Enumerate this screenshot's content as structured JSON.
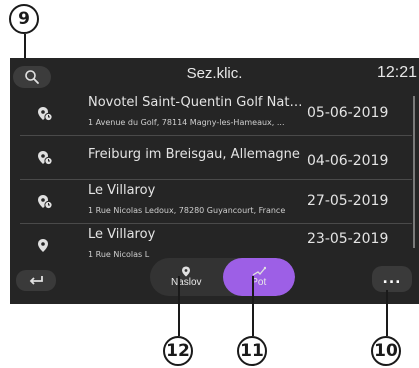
{
  "callouts": {
    "search": "9",
    "address": "12",
    "route": "11",
    "more": "10"
  },
  "header": {
    "title": "Sez.klic.",
    "time": "12:21"
  },
  "list": [
    {
      "name": "Novotel Saint-Quentin Golf Natio...",
      "address": "1 Avenue du Golf, 78114 Magny-les-Hameaux, ...",
      "date": "05-06-2019"
    },
    {
      "name": "Freiburg im Breisgau, Allemagne",
      "address": "",
      "date": "04-06-2019"
    },
    {
      "name": "Le Villaroy",
      "address": "1 Rue Nicolas Ledoux, 78280 Guyancourt, France",
      "date": "27-05-2019"
    },
    {
      "name": "Le Villaroy",
      "address": "1 Rue Nicolas L",
      "date": "23-05-2019"
    }
  ],
  "bottom": {
    "address_tab": "Naslov",
    "route_tab": "Pot",
    "more": "..."
  },
  "colors": {
    "accent": "#9d5fe6",
    "background": "#252525"
  },
  "icons": {
    "search": "search-icon",
    "pin": "pin-clock-icon",
    "back": "back-arrow-icon",
    "address": "location-pin-icon",
    "route": "route-icon"
  }
}
